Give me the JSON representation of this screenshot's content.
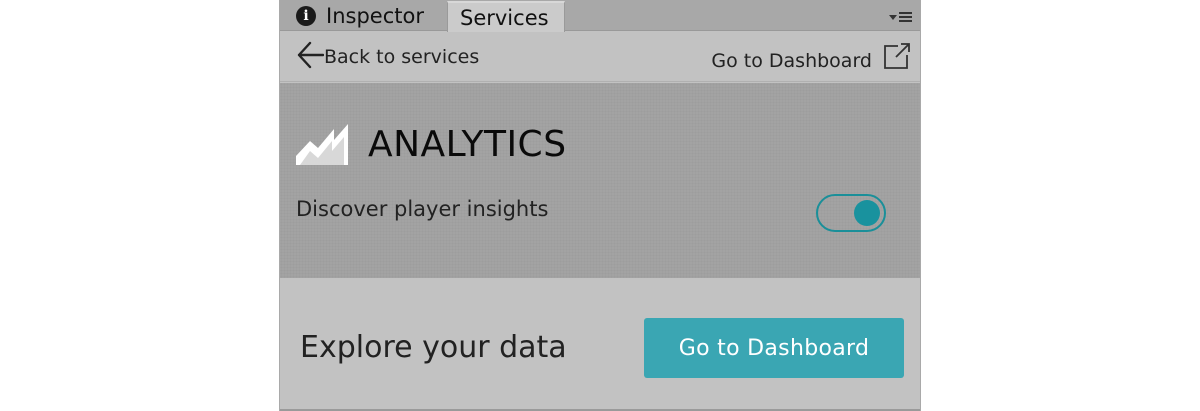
{
  "tabs": {
    "inspector_label": "Inspector",
    "services_label": "Services"
  },
  "nav": {
    "back_label": "Back to services",
    "dashboard_link_label": "Go to Dashboard"
  },
  "analytics": {
    "title": "ANALYTICS",
    "subtitle": "Discover player insights",
    "toggle_on": true
  },
  "explore": {
    "label": "Explore your data",
    "button_label": "Go to Dashboard"
  },
  "colors": {
    "accent": "#3aa6b3",
    "toggle": "#19929e"
  },
  "icons": {
    "inspector": "info-icon",
    "back": "arrow-left-icon",
    "external": "external-link-icon",
    "analytics": "analytics-chart-icon",
    "tab_menu": "tab-menu-icon"
  }
}
